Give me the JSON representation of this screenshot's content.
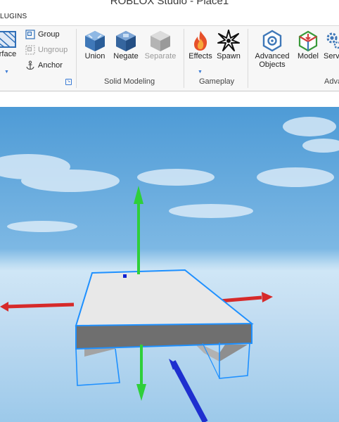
{
  "window": {
    "title": "ROBLOX Studio - Place1"
  },
  "tabs": {
    "active_partial": "LUGINS"
  },
  "ribbon": {
    "surface_label": "rface",
    "group_label": "Group",
    "ungroup_label": "Ungroup",
    "anchor_label": "Anchor",
    "union_label": "Union",
    "negate_label": "Negate",
    "separate_label": "Separate",
    "effects_label": "Effects",
    "spawn_label": "Spawn",
    "advanced_objects_line1": "Advanced",
    "advanced_objects_line2": "Objects",
    "model_label": "Model",
    "service_partial": "Serv",
    "groups": {
      "solid_modeling": "Solid Modeling",
      "gameplay": "Gameplay",
      "advanced_partial": "Adva"
    }
  },
  "colors": {
    "sky_top": "#4e9bd6",
    "sky_horizon": "#cfe6f6",
    "baseplate_top": "#e8e8e8",
    "selection": "#1e90ff",
    "axis_x": "#d62a2a",
    "axis_y": "#2fcf3a",
    "axis_z": "#1e2fcf"
  }
}
